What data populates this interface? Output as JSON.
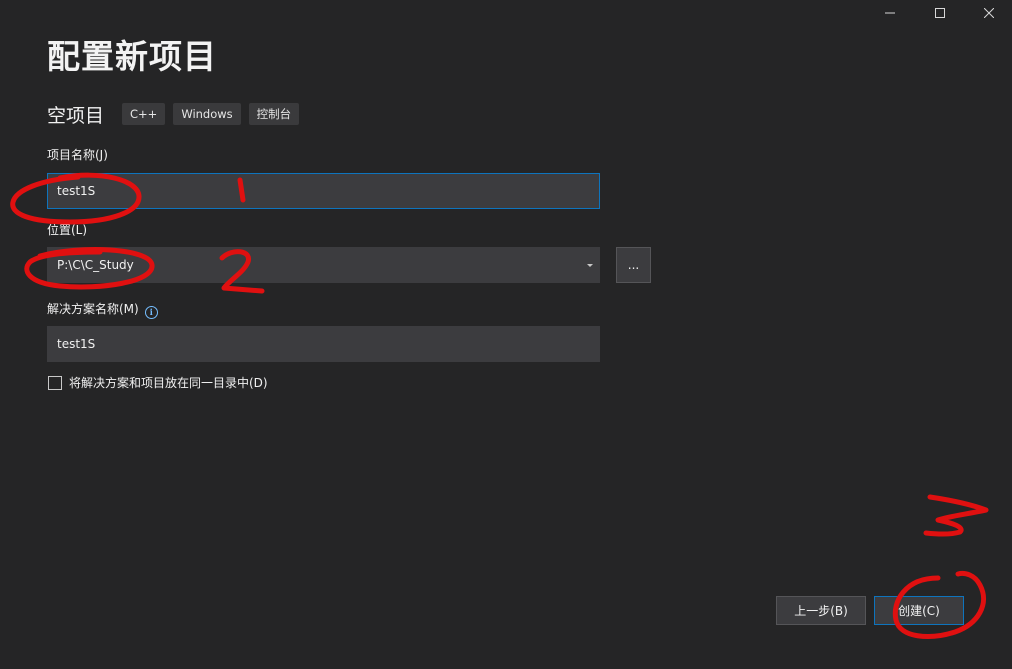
{
  "window_controls": {
    "minimize_icon": "minimize-icon",
    "maximize_icon": "maximize-icon",
    "close_icon": "close-icon"
  },
  "page_title": "配置新项目",
  "template": {
    "name": "空项目",
    "tags": [
      "C++",
      "Windows",
      "控制台"
    ]
  },
  "form": {
    "project_name": {
      "label": "项目名称(J)",
      "value": "test1S"
    },
    "location": {
      "label": "位置(L)",
      "value": "P:\\C\\C_Study",
      "browse_label": "..."
    },
    "solution_name": {
      "label": "解决方案名称(M)",
      "info_icon": "info-icon",
      "value": "test1S"
    },
    "same_directory": {
      "label": "将解决方案和项目放在同一目录中(D)",
      "checked": false
    }
  },
  "footer": {
    "back_label": "上一步(B)",
    "create_label": "创建(C)"
  },
  "annotations": {
    "color": "#e01010",
    "marks": [
      "1",
      "2",
      "3"
    ]
  },
  "colors": {
    "background": "#252526",
    "input_background": "#3c3c3f",
    "focus_accent": "#0e74bd",
    "info_accent": "#75beff"
  }
}
